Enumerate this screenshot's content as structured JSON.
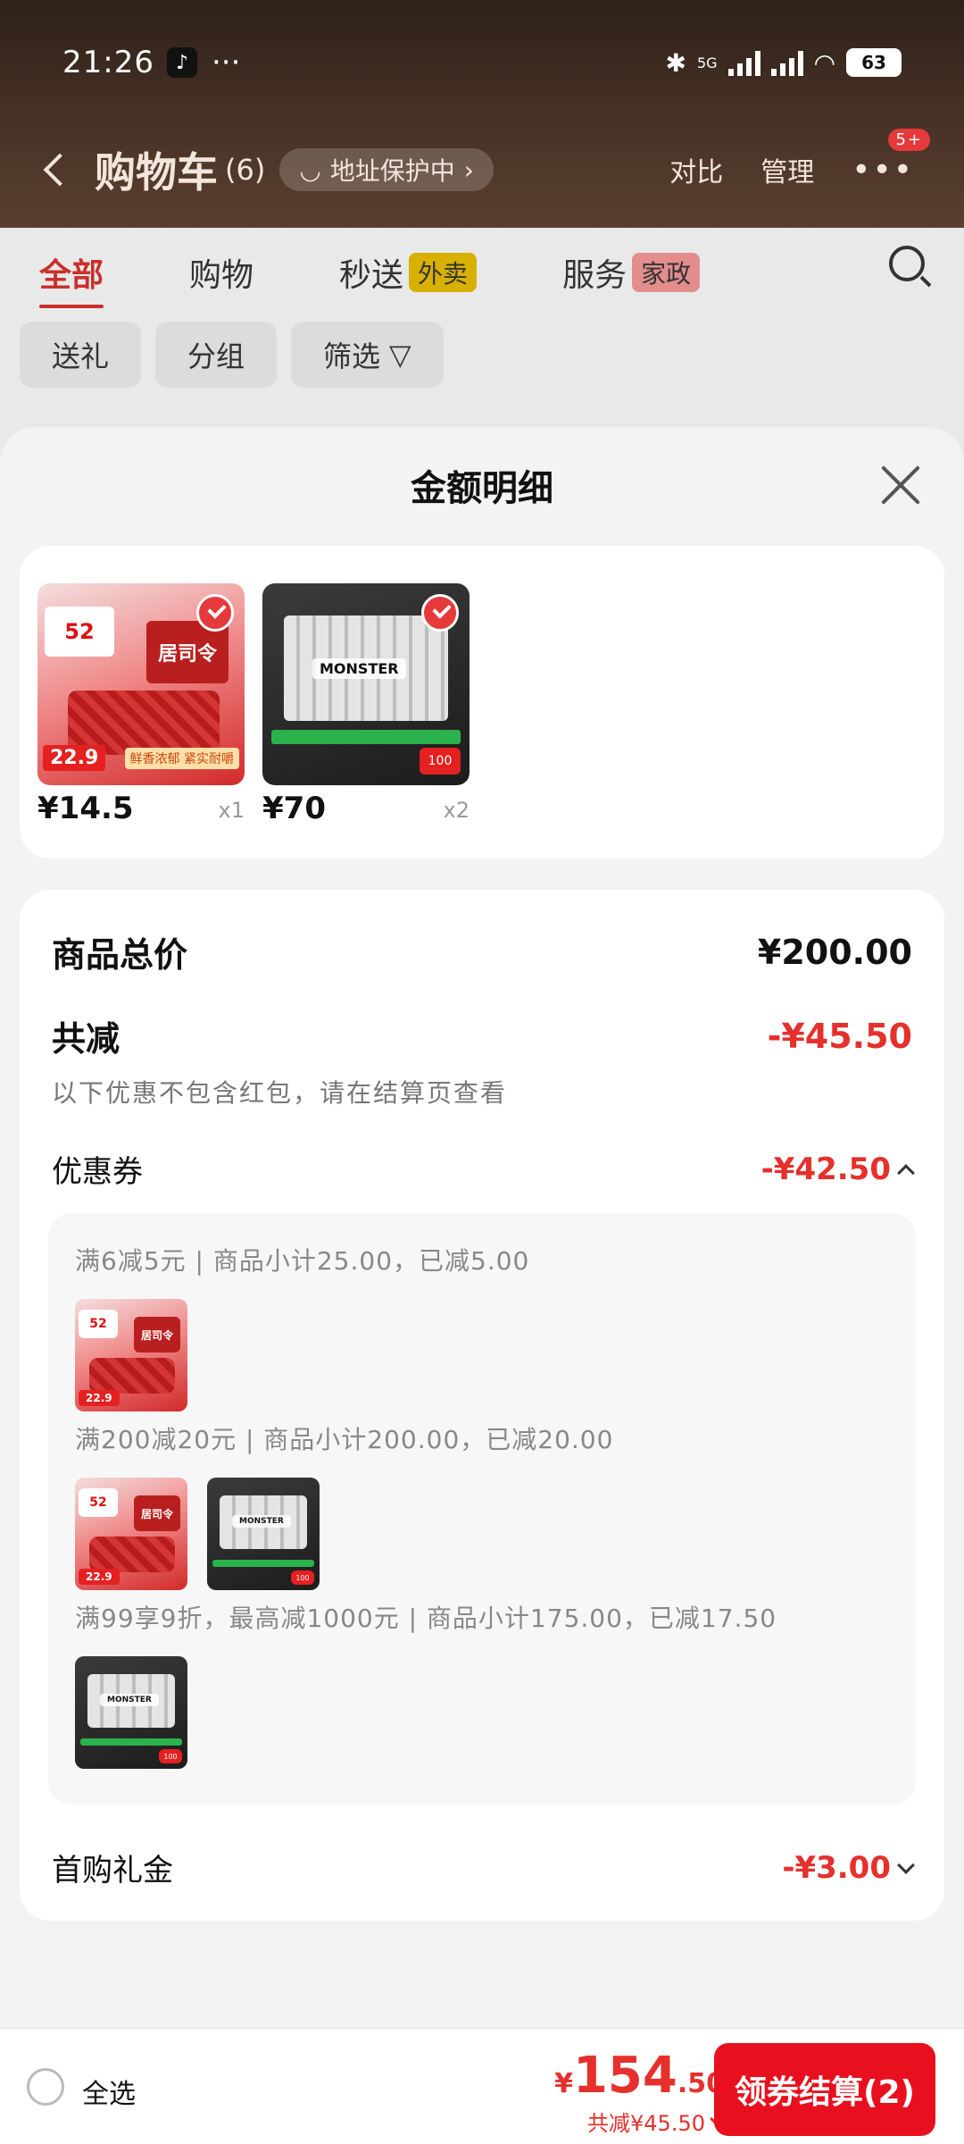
{
  "status_bar": {
    "time": "21:26",
    "network": "5G",
    "battery": "63"
  },
  "nav": {
    "title": "购物车",
    "count": "(6)",
    "address_pill": "地址保护中",
    "compare": "对比",
    "manage": "管理",
    "badge": "5+"
  },
  "tabs": [
    {
      "label": "全部",
      "tag": ""
    },
    {
      "label": "购物",
      "tag": ""
    },
    {
      "label": "秒送",
      "tag": "外卖"
    },
    {
      "label": "服务",
      "tag": "家政"
    }
  ],
  "chips": [
    "送礼",
    "分组",
    "筛选"
  ],
  "sheet": {
    "title": "金额明细",
    "products": [
      {
        "price": "¥14.5",
        "qty": "x1",
        "brand": "居司令",
        "badge": "52",
        "tag_price": "22.9",
        "banner": "鲜香浓郁 紧实耐嚼"
      },
      {
        "price": "¥70",
        "qty": "x2",
        "brand": "MONSTER",
        "badge": "100"
      }
    ],
    "total_label": "商品总价",
    "total_value": "¥200.00",
    "discount_label": "共减",
    "discount_value": "-¥45.50",
    "discount_note": "以下优惠不包含红包，请在结算页查看",
    "coupon_label": "优惠券",
    "coupon_value": "-¥42.50",
    "coupons": [
      "满6减5元 | 商品小计25.00，已减5.00",
      "满200减20元 | 商品小计200.00，已减20.00",
      "满99享9折，最高减1000元 | 商品小计175.00，已减17.50"
    ],
    "first_gift_label": "首购礼金",
    "first_gift_value": "-¥3.00"
  },
  "bottom": {
    "select_all": "全选",
    "currency": "¥",
    "price_int": "154",
    "price_dec": ".50",
    "discount_text": "共减¥45.50",
    "checkout": "领券结算(2)"
  }
}
